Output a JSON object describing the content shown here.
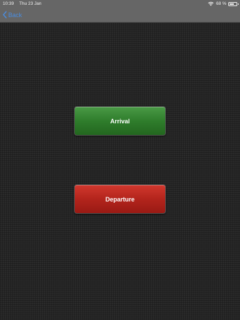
{
  "status_bar": {
    "time": "10:39",
    "date": "Thu 23 Jan",
    "battery_percent": "68 %",
    "battery_level": 0.68
  },
  "nav": {
    "back_label": "Back",
    "accent_color": "#4a8de0"
  },
  "buttons": {
    "arrival_label": "Arrival",
    "departure_label": "Departure",
    "arrival_color": "#2f7d2c",
    "departure_color": "#b3241c"
  },
  "icons": {
    "back": "chevron-left-icon",
    "wifi": "wifi-icon",
    "battery": "battery-icon"
  }
}
